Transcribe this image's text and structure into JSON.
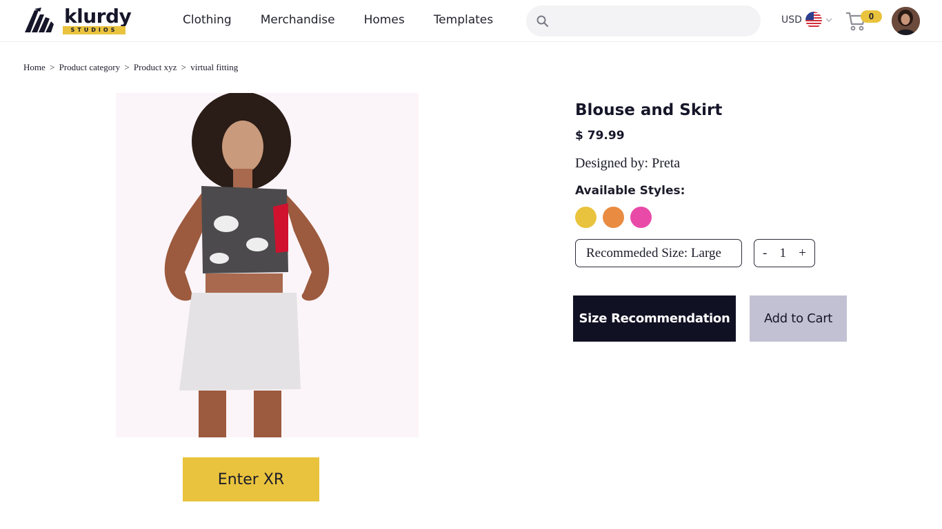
{
  "brand": {
    "name": "klurdy",
    "sub": "STUDIOS",
    "accent": "#e9c33d",
    "dark": "#16162a"
  },
  "nav": {
    "items": [
      {
        "label": "Clothing"
      },
      {
        "label": "Merchandise"
      },
      {
        "label": "Homes"
      },
      {
        "label": "Templates"
      }
    ]
  },
  "search": {
    "placeholder": "",
    "value": "",
    "icon": "search-icon"
  },
  "currency": {
    "label": "USD",
    "flag": "us-flag-icon"
  },
  "cart": {
    "icon": "cart-icon",
    "count": "0"
  },
  "breadcrumb": {
    "items": [
      "Home",
      "Product category",
      "Product xyz",
      "virtual fitting"
    ],
    "separator": ">"
  },
  "product": {
    "title": "Blouse and Skirt",
    "price": "$ 79.99",
    "designer": "Designed by: Preta",
    "styles_label": "Available Styles:",
    "styles": [
      {
        "color": "#e9c33d"
      },
      {
        "color": "#e98c42"
      },
      {
        "color": "#e94aa8"
      }
    ],
    "size_recommendation": "Recommeded Size: Large",
    "quantity": {
      "minus": "-",
      "value": "1",
      "plus": "+"
    }
  },
  "actions": {
    "size_recommendation": "Size Recommendation",
    "add_to_cart": "Add to Cart",
    "enter_xr": "Enter XR"
  }
}
